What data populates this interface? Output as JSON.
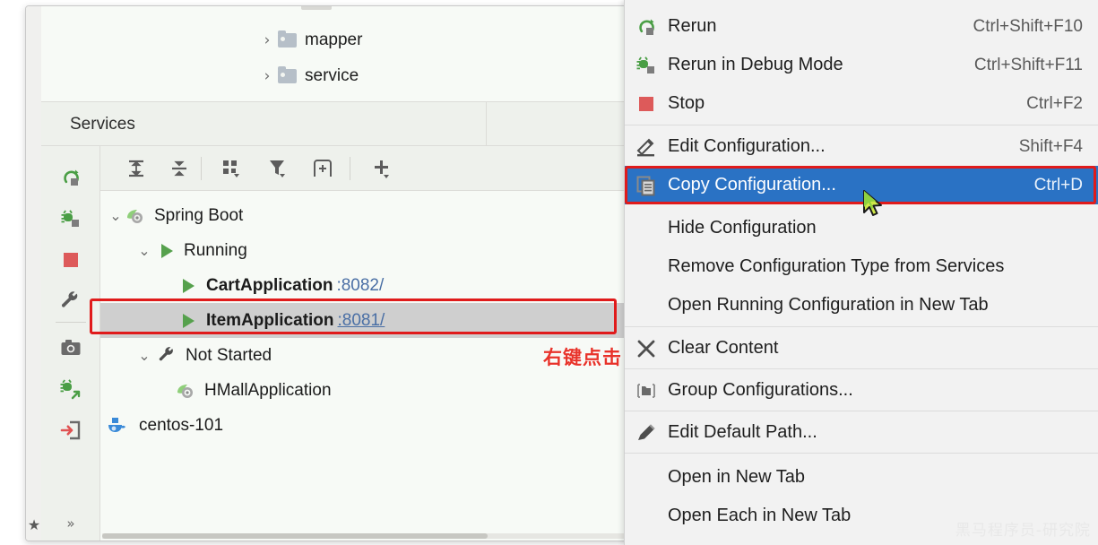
{
  "project_tree": {
    "items": [
      {
        "label": "mapper",
        "icon": "folder-icon",
        "chevron": "›"
      },
      {
        "label": "service",
        "icon": "folder-icon",
        "chevron": "›"
      }
    ]
  },
  "services_panel": {
    "title": "Services",
    "vertical_toolbar": [
      {
        "name": "rerun-icon",
        "tooltip": "Rerun"
      },
      {
        "name": "rerun-debug-icon",
        "tooltip": "Rerun in Debug Mode"
      },
      {
        "name": "stop-icon",
        "tooltip": "Stop"
      },
      {
        "name": "wrench-icon",
        "tooltip": "Edit Configuration"
      },
      {
        "name": "camera-icon",
        "tooltip": "Capture Memory Snapshot"
      },
      {
        "name": "attach-debug-icon",
        "tooltip": "Attach Debugger"
      },
      {
        "name": "exit-icon",
        "tooltip": "Exit"
      }
    ],
    "vertical_toolbar_more": "»",
    "horizontal_toolbar": [
      {
        "name": "rerun-icon"
      },
      {
        "name": "expand-all-icon"
      },
      {
        "name": "collapse-all-icon"
      },
      {
        "name": "group-by-icon"
      },
      {
        "name": "filter-icon"
      },
      {
        "name": "show-tab-icon"
      },
      {
        "name": "add-icon"
      }
    ],
    "tree": [
      {
        "label": "Spring Boot",
        "chevron": "⌄",
        "icon": "spring-boot-icon",
        "indent": 0,
        "bold": false,
        "selected": false
      },
      {
        "label": "Running",
        "chevron": "⌄",
        "icon": "run-triangle-icon",
        "indent": 1,
        "bold": false,
        "selected": false
      },
      {
        "label": "CartApplication",
        "chevron": "",
        "icon": "run-triangle-icon",
        "indent": 2,
        "bold": true,
        "selected": false,
        "port": ":8082/",
        "port_underline": false
      },
      {
        "label": "ItemApplication",
        "chevron": "",
        "icon": "run-triangle-icon",
        "indent": 2,
        "bold": true,
        "selected": true,
        "port": ":8081/",
        "port_underline": true
      },
      {
        "label": "Not Started",
        "chevron": "⌄",
        "icon": "wrench-icon",
        "indent": 1,
        "bold": false,
        "selected": false
      },
      {
        "label": "HMallApplication",
        "chevron": "",
        "icon": "spring-boot-icon",
        "indent": 2,
        "bold": false,
        "selected": false
      },
      {
        "label": "centos-101",
        "chevron": "",
        "icon": "docker-icon",
        "indent": 0,
        "bold": false,
        "selected": false
      }
    ]
  },
  "favorites_strip": {
    "label": "Favorites",
    "icon": "star-icon"
  },
  "context_menu": {
    "items": [
      {
        "label": "Rerun",
        "accelerator": "Ctrl+Shift+F10",
        "icon": "rerun-icon",
        "highlighted": false
      },
      {
        "label": "Rerun in Debug Mode",
        "accelerator": "Ctrl+Shift+F11",
        "icon": "rerun-debug-icon",
        "highlighted": false
      },
      {
        "label": "Stop",
        "accelerator": "Ctrl+F2",
        "icon": "stop-icon",
        "highlighted": false
      },
      {
        "label": "Edit Configuration...",
        "accelerator": "Shift+F4",
        "icon": "edit-pencil-icon",
        "highlighted": false
      },
      {
        "label": "Copy Configuration...",
        "accelerator": "Ctrl+D",
        "icon": "copy-icon",
        "highlighted": true
      },
      {
        "label": "Hide Configuration",
        "accelerator": "",
        "icon": "",
        "highlighted": false
      },
      {
        "label": "Remove Configuration Type from Services",
        "accelerator": "",
        "icon": "",
        "highlighted": false
      },
      {
        "label": "Open Running Configuration in New Tab",
        "accelerator": "",
        "icon": "",
        "highlighted": false
      },
      {
        "label": "Clear Content",
        "accelerator": "",
        "icon": "close-x-icon",
        "highlighted": false
      },
      {
        "label": "Group Configurations...",
        "accelerator": "",
        "icon": "group-folder-icon",
        "highlighted": false
      },
      {
        "label": "Edit Default Path...",
        "accelerator": "",
        "icon": "pencil-icon",
        "highlighted": false
      },
      {
        "label": "Open in New Tab",
        "accelerator": "",
        "icon": "",
        "highlighted": false
      },
      {
        "label": "Open Each in New Tab",
        "accelerator": "",
        "icon": "",
        "highlighted": false
      }
    ]
  },
  "annotations": {
    "right_click_note": "右键点击",
    "watermark": "黑马程序员-研究院"
  },
  "colors": {
    "menu_highlight": "#2a72c4",
    "annotation_red": "#e8332a",
    "highlight_box_red": "#e01b1b",
    "run_green": "#56a14d",
    "stop_red": "#dd5a5a",
    "link_blue": "#4a6fa5",
    "docker_blue": "#3a8ad8"
  }
}
